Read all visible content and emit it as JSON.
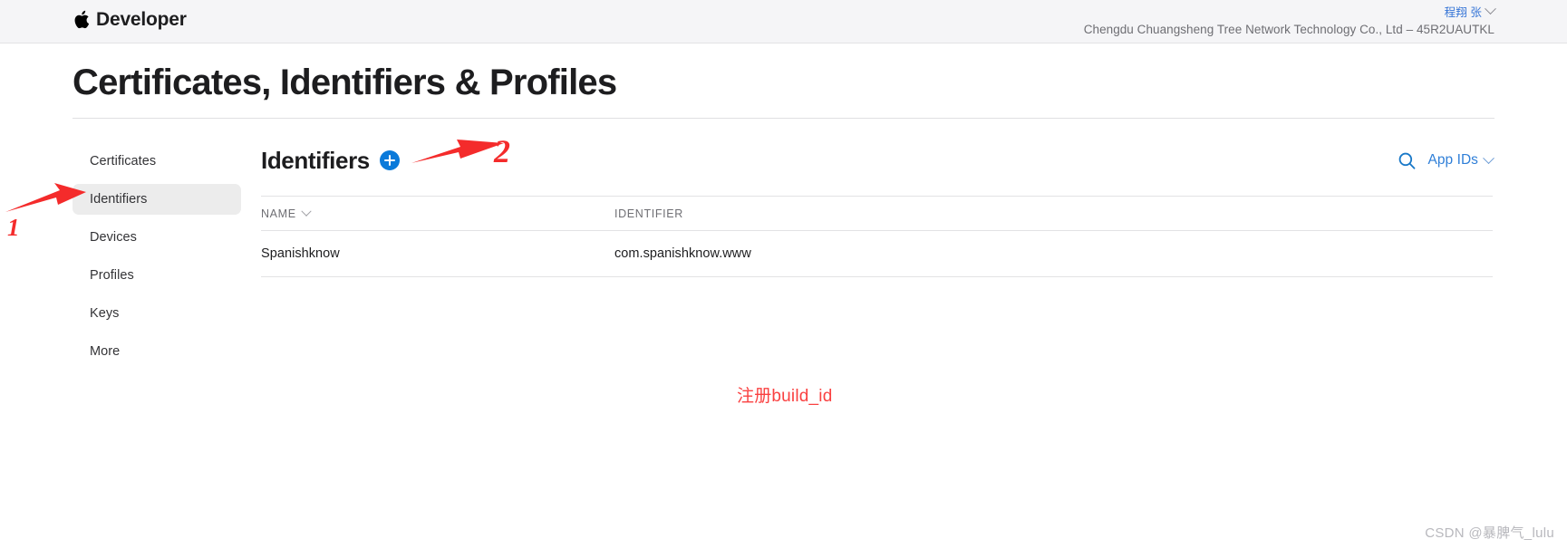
{
  "topbar": {
    "brand": "Developer",
    "apple_logo_icon": "apple-logo-icon",
    "account_name": "程翔 张",
    "account_chevron_icon": "chevron-down-icon",
    "team": "Chengdu Chuangsheng Tree Network Technology Co., Ltd – 45R2UAUTKL"
  },
  "page": {
    "title": "Certificates, Identifiers & Profiles"
  },
  "sidebar": {
    "items": [
      {
        "label": "Certificates",
        "active": false
      },
      {
        "label": "Identifiers",
        "active": true
      },
      {
        "label": "Devices",
        "active": false
      },
      {
        "label": "Profiles",
        "active": false
      },
      {
        "label": "Keys",
        "active": false
      },
      {
        "label": "More",
        "active": false
      }
    ]
  },
  "content": {
    "section_title": "Identifiers",
    "add_button_label": "+",
    "add_button_icon": "plus-circle-icon",
    "search_icon": "search-icon",
    "filter": {
      "label": "App IDs",
      "chevron_icon": "chevron-down-icon"
    },
    "table": {
      "columns": [
        {
          "label": "NAME",
          "sort_icon": "chevron-down-icon"
        },
        {
          "label": "IDENTIFIER",
          "sort_icon": ""
        }
      ],
      "rows": [
        {
          "name": "Spanishknow",
          "identifier": "com.spanishknow.www"
        }
      ]
    }
  },
  "annotations": {
    "marker_one": "1",
    "marker_two": "2",
    "caption": "注册build_id",
    "arrow_sidebar_icon": "red-arrow-left-icon",
    "arrow_addbutton_icon": "red-arrow-left-icon",
    "color": "#f42b2b"
  },
  "watermark": {
    "text": "CSDN @暴脾气_lulu"
  }
}
